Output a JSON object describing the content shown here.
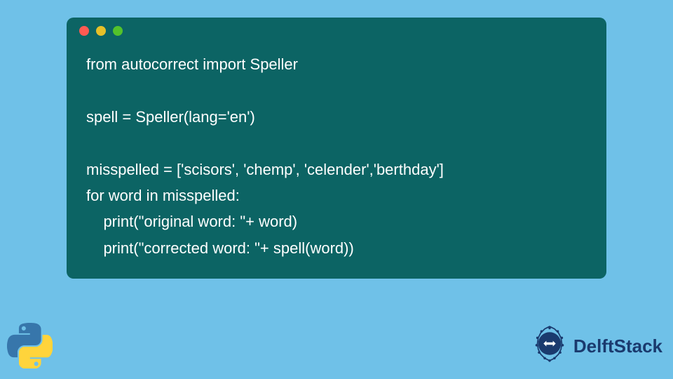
{
  "code": {
    "line1": "from autocorrect import Speller",
    "line2": "",
    "line3": "spell = Speller(lang='en')",
    "line4": "",
    "line5": "misspelled = ['scisors', 'chemp', 'celender','berthday']",
    "line6": "for word in misspelled:",
    "line7": "    print(\"original word: \"+ word)",
    "line8": "    print(\"corrected word: \"+ spell(word))"
  },
  "branding": {
    "name": "DelftStack"
  },
  "colors": {
    "bg": "#6fc1e8",
    "window": "#0c6464",
    "dot_red": "#ff5a52",
    "dot_yellow": "#e6c029",
    "dot_green": "#53c22b"
  }
}
